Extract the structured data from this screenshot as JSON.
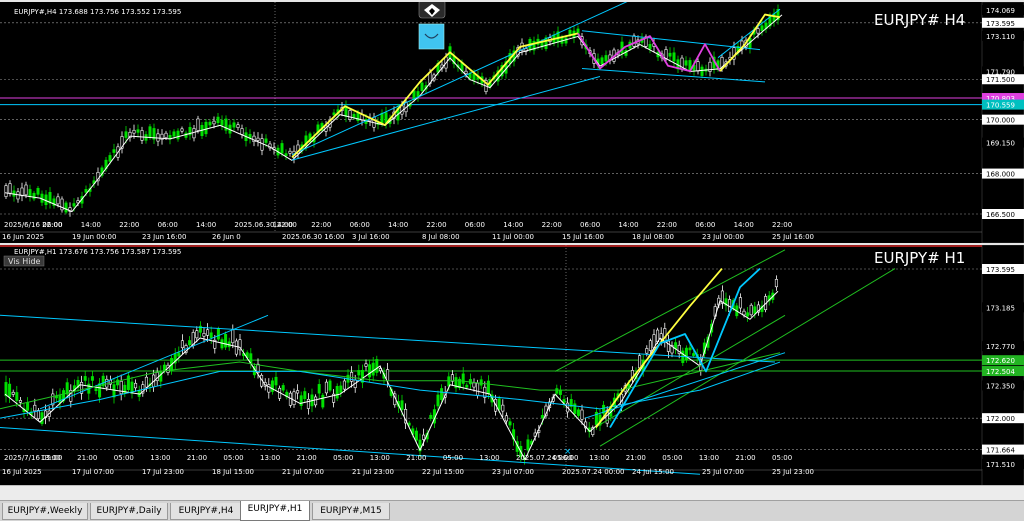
{
  "tabs": [
    {
      "label": "EURJPY#,Weekly",
      "active": false
    },
    {
      "label": "EURJPY#,Daily",
      "active": false
    },
    {
      "label": "EURJPY#,H4",
      "active": false
    },
    {
      "label": "EURJPY#,H1",
      "active": true
    },
    {
      "label": "EURJPY#,M15",
      "active": false
    }
  ],
  "h4": {
    "info": "EURJPY#,H4  173.688 173.756 173.552 173.595",
    "watermark": "EURJPY#  H4",
    "price_labels": [
      {
        "text": "174.069",
        "value": 174.069,
        "bg": "#000000",
        "fg": "#ffffff"
      },
      {
        "text": "173.595",
        "value": 173.595,
        "bg": "#ffffff",
        "fg": "#000000"
      },
      {
        "text": "173.110",
        "value": 173.11,
        "bg": "#000000",
        "fg": "#ffffff"
      },
      {
        "text": "171.790",
        "value": 171.79,
        "bg": "#000000",
        "fg": "#ffffff"
      },
      {
        "text": "171.500",
        "value": 171.5,
        "bg": "#ffffff",
        "fg": "#000000"
      },
      {
        "text": "170.803",
        "value": 170.803,
        "bg": "#e040e0",
        "fg": "#ffffff"
      },
      {
        "text": "170.559",
        "value": 170.559,
        "bg": "#00c0c0",
        "fg": "#ffffff"
      },
      {
        "text": "170.000",
        "value": 170.0,
        "bg": "#ffffff",
        "fg": "#000000"
      },
      {
        "text": "169.150",
        "value": 169.15,
        "bg": "#000000",
        "fg": "#ffffff"
      },
      {
        "text": "168.000",
        "value": 168.0,
        "bg": "#ffffff",
        "fg": "#000000"
      },
      {
        "text": "166.500",
        "value": 166.5,
        "bg": "#ffffff",
        "fg": "#000000"
      }
    ],
    "time_row1": [
      "2025/6/16 22:00",
      "06:00",
      "14:00",
      "22:00",
      "06:00",
      "14:00",
      "2025.06.30 22:00",
      "14:00",
      "22:00",
      "06:00",
      "14:00",
      "22:00",
      "06:00",
      "14:00",
      "22:00",
      "06:00",
      "14:00",
      "22:00",
      "06:00",
      "14:00",
      "22:00"
    ],
    "time_row2": [
      "16 Jun 2025",
      "19 Jun 00:00",
      "23 Jun 16:00",
      "26 Jun 0",
      "2025.06.30 16:00",
      "3 Jul 16:00",
      "8 Jul 08:00",
      "11 Jul 00:00",
      "15 Jul 16:00",
      "18 Jul 08:00",
      "23 Jul 00:00",
      "25 Jul 16:00"
    ]
  },
  "h1": {
    "info": "EURJPY#,H1  173.676 173.756 173.587 173.595",
    "hide_label": "Vis Hide",
    "watermark": "EURJPY#  H1",
    "price_labels": [
      {
        "text": "173.595",
        "value": 173.595,
        "bg": "#ffffff",
        "fg": "#000000"
      },
      {
        "text": "173.185",
        "value": 173.185,
        "bg": "#000000",
        "fg": "#ffffff"
      },
      {
        "text": "172.770",
        "value": 172.77,
        "bg": "#000000",
        "fg": "#ffffff"
      },
      {
        "text": "172.620",
        "value": 172.62,
        "bg": "#22b422",
        "fg": "#ffffff"
      },
      {
        "text": "172.504",
        "value": 172.504,
        "bg": "#22b422",
        "fg": "#ffffff"
      },
      {
        "text": "172.350",
        "value": 172.35,
        "bg": "#000000",
        "fg": "#ffffff"
      },
      {
        "text": "172.000",
        "value": 172.0,
        "bg": "#ffffff",
        "fg": "#000000"
      },
      {
        "text": "171.664",
        "value": 171.664,
        "bg": "#ffffff",
        "fg": "#000000"
      },
      {
        "text": "171.510",
        "value": 171.51,
        "bg": "#000000",
        "fg": "#ffffff"
      }
    ],
    "time_row": [
      "2025/7/16 05:00",
      "13:00",
      "21:00",
      "05:00",
      "13:00",
      "21:00",
      "05:00",
      "13:00",
      "21:00",
      "05:00",
      "13:00",
      "21:00",
      "05:00",
      "13:00",
      "2025.07.24 06:00",
      "05:00",
      "13:00",
      "21:00",
      "05:00",
      "13:00",
      "21:00",
      "05:00"
    ],
    "time_row2": [
      "16 Jul 2025",
      "17 Jul 07:00",
      "17 Jul 23:00",
      "18 Jul 15:00",
      "21 Jul 07:00",
      "21 Jul 23:00",
      "22 Jul 15:00",
      "23 Jul 07:00",
      "2025.07.24 00:00",
      "24 Jul 15:00",
      "25 Jul 07:00",
      "25 Jul 23:00"
    ]
  },
  "colors": {
    "bull": "#00e000",
    "bear": "#ffffff",
    "grid": "#8a8a8a",
    "channel": "#00c8ff",
    "zigzag_yellow": "#ffff40",
    "zigzag_magenta": "#e040e0",
    "ma_green": "#20c020"
  }
}
